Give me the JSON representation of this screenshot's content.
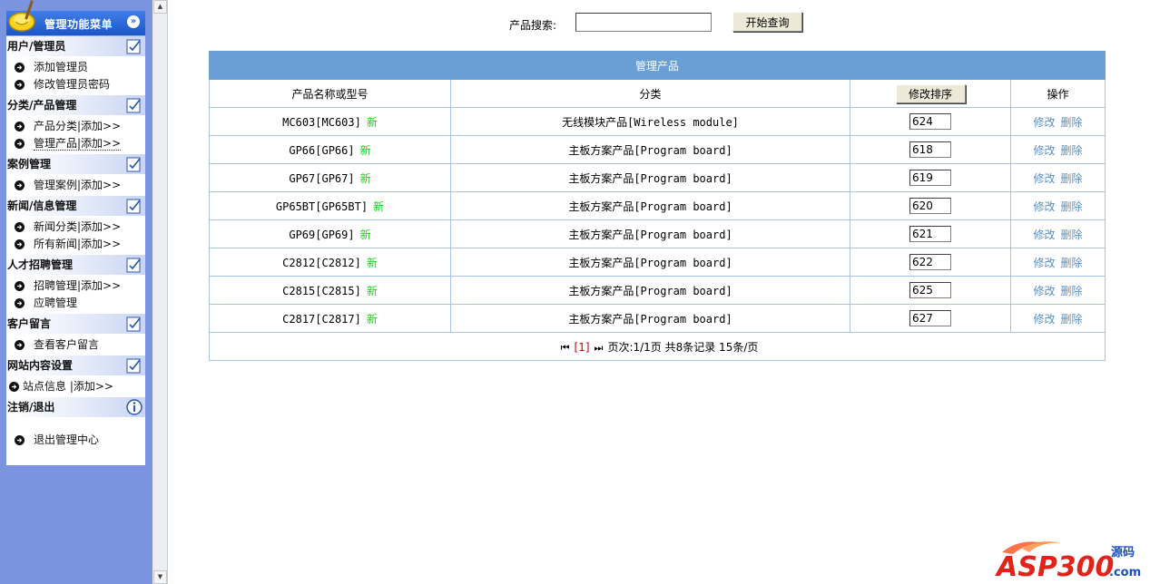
{
  "sidebar": {
    "header_title": "管理功能菜单",
    "sections": [
      {
        "title": "用户/管理员",
        "items": [
          {
            "label": "添加管理员"
          },
          {
            "label": "修改管理员密码"
          }
        ]
      },
      {
        "title": "分类/产品管理",
        "items": [
          {
            "label": "产品分类|添加>>"
          },
          {
            "label": "管理产品|添加>>"
          }
        ]
      },
      {
        "title": "案例管理",
        "items": [
          {
            "label": "管理案例|添加>>"
          }
        ]
      },
      {
        "title": "新闻/信息管理",
        "items": [
          {
            "label": "新闻分类|添加>>"
          },
          {
            "label": "所有新闻|添加>>"
          }
        ]
      },
      {
        "title": "人才招聘管理",
        "items": [
          {
            "label": "招聘管理|添加>>"
          },
          {
            "label": "应聘管理"
          }
        ]
      },
      {
        "title": "客户留言",
        "items": [
          {
            "label": "查看客户留言"
          }
        ]
      },
      {
        "title": "网站内容设置",
        "items": [
          {
            "label": "站点信息 |添加>>"
          }
        ]
      },
      {
        "title": "注销/退出",
        "items": [
          {
            "label": "退出管理中心"
          }
        ]
      }
    ]
  },
  "search": {
    "label": "产品搜索:",
    "value": "",
    "button_label": "开始查询"
  },
  "table": {
    "caption": "管理产品",
    "headers": {
      "name": "产品名称或型号",
      "category": "分类",
      "sort_button": "修改排序",
      "actions": "操作"
    },
    "new_label": "新",
    "edit_label": "修改",
    "delete_label": "删除",
    "rows": [
      {
        "name": "MC603[MC603]",
        "category": "无线模块产品[Wireless module]",
        "order": "624"
      },
      {
        "name": "GP66[GP66]",
        "category": "主板方案产品[Program board]",
        "order": "618"
      },
      {
        "name": "GP67[GP67]",
        "category": "主板方案产品[Program board]",
        "order": "619"
      },
      {
        "name": "GP65BT[GP65BT]",
        "category": "主板方案产品[Program board]",
        "order": "620"
      },
      {
        "name": "GP69[GP69]",
        "category": "主板方案产品[Program board]",
        "order": "621"
      },
      {
        "name": "C2812[C2812]",
        "category": "主板方案产品[Program board]",
        "order": "622"
      },
      {
        "name": "C2815[C2815]",
        "category": "主板方案产品[Program board]",
        "order": "625"
      },
      {
        "name": "C2817[C2817]",
        "category": "主板方案产品[Program board]",
        "order": "627"
      }
    ],
    "pager": {
      "current": "[1]",
      "info": "页次:1/1页 共8条记录 15条/页"
    }
  },
  "watermark": {
    "text": "ASP300",
    "suffix": "源码",
    "domain": ".com"
  },
  "colors": {
    "sidebar_bg": "#7b94e0",
    "header_blue": "#1c56c8",
    "table_caption": "#6a9fd6",
    "table_border": "#a7c4e6",
    "new_tag": "#1cd11c",
    "link": "#5a8fc8",
    "pager_current": "#cc0000"
  }
}
